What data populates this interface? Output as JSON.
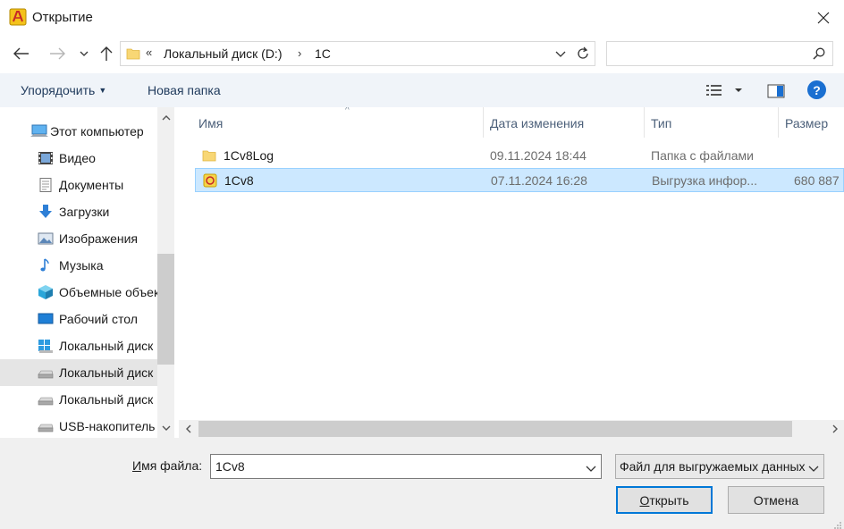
{
  "window": {
    "title": "Открытие"
  },
  "address": {
    "chevron": "«",
    "segments": [
      "Локальный диск (D:)",
      "1C"
    ],
    "separator": "›"
  },
  "search": {
    "placeholder": ""
  },
  "toolbar": {
    "organize_label": "Упорядочить",
    "new_folder_label": "Новая папка",
    "help_label": "?"
  },
  "nav_pane": {
    "items": [
      {
        "label": "Этот компьютер",
        "icon": "computer-icon"
      },
      {
        "label": "Видео",
        "icon": "video-icon"
      },
      {
        "label": "Документы",
        "icon": "documents-icon"
      },
      {
        "label": "Загрузки",
        "icon": "downloads-icon"
      },
      {
        "label": "Изображения",
        "icon": "pictures-icon"
      },
      {
        "label": "Музыка",
        "icon": "music-icon"
      },
      {
        "label": "Объемные объекты",
        "icon": "3d-objects-icon"
      },
      {
        "label": "Рабочий стол",
        "icon": "desktop-icon"
      },
      {
        "label": "Локальный диск (C:)",
        "icon": "windows-drive-icon"
      },
      {
        "label": "Локальный диск (D:)",
        "icon": "drive-icon",
        "selected": true
      },
      {
        "label": "Локальный диск",
        "icon": "drive-icon"
      },
      {
        "label": "USB-накопитель",
        "icon": "usb-drive-icon"
      }
    ]
  },
  "columns": {
    "name": "Имя",
    "date": "Дата изменения",
    "type": "Тип",
    "size": "Размер"
  },
  "files": [
    {
      "name": "1Cv8Log",
      "date": "09.11.2024 18:44",
      "type": "Папка с файлами",
      "size": "",
      "icon": "folder-icon"
    },
    {
      "name": "1Cv8",
      "date": "07.11.2024 16:28",
      "type": "Выгрузка инфор...",
      "size": "680 887",
      "icon": "1c-file-icon",
      "selected": true
    }
  ],
  "file_name": {
    "label_prefix": "И",
    "label_rest": "мя файла:",
    "value": "1Cv8"
  },
  "file_type": {
    "value": "Файл для выгружаемых данных"
  },
  "buttons": {
    "open_u": "О",
    "open_rest": "ткрыть",
    "cancel": "Отмена"
  },
  "colors": {
    "selection_bg": "#cce8ff",
    "selection_border": "#99d1ff",
    "accent": "#0078d7",
    "toolbar_bg": "#f0f4f9",
    "bottom_bg": "#f0f0f0"
  }
}
